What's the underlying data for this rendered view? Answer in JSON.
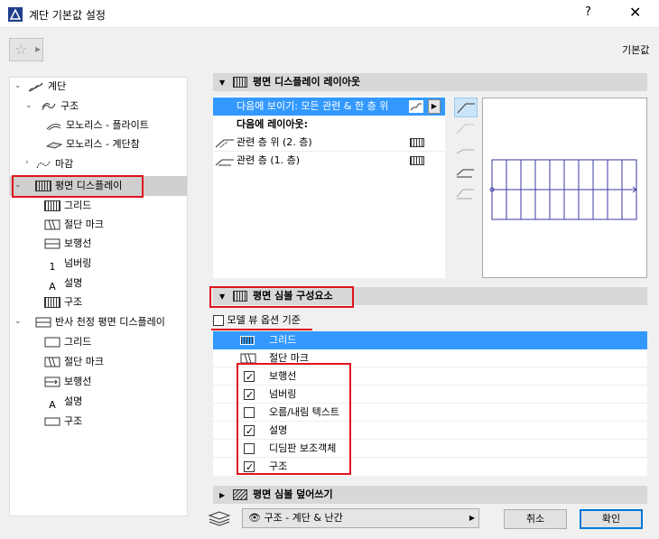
{
  "window": {
    "title": "계단 기본값 설정",
    "help": "?",
    "close": "✕"
  },
  "toolbar": {
    "favorites_icon": "star-icon",
    "default_label": "기본값"
  },
  "tree": {
    "items": [
      {
        "label": "계단"
      },
      {
        "label": "구조"
      },
      {
        "label": "모노리스 - 플라이트"
      },
      {
        "label": "모노리스 - 계단참"
      },
      {
        "label": "마감"
      },
      {
        "label": "평면 디스플레이"
      },
      {
        "label": "그리드"
      },
      {
        "label": "절단 마크"
      },
      {
        "label": "보행선"
      },
      {
        "label": "넘버링"
      },
      {
        "label": "설명"
      },
      {
        "label": "구조"
      },
      {
        "label": "반사 천정 평면 디스플레이"
      },
      {
        "label": "그리드"
      },
      {
        "label": "절단 마크"
      },
      {
        "label": "보행선"
      },
      {
        "label": "설명"
      },
      {
        "label": "구조"
      }
    ]
  },
  "layout_panel": {
    "title": "평면 디스플레이 레이아웃",
    "show_on": "다음에 보이기: 모든 관련 & 한 층 위",
    "layout_on": "다음에 레이아웃:",
    "rows": [
      {
        "label": "관련 층 위 (2. 층)"
      },
      {
        "label": "관련 층 (1. 층)"
      }
    ]
  },
  "components_panel": {
    "title": "평면 심볼 구성요소",
    "model_view_label": "모델 뷰 옵션 기준",
    "model_view_checked": false,
    "items": [
      {
        "label": "그리드",
        "checked": null,
        "selected": true
      },
      {
        "label": "절단 마크",
        "checked": null,
        "selected": false
      },
      {
        "label": "보행선",
        "checked": true,
        "selected": false
      },
      {
        "label": "넘버링",
        "checked": true,
        "selected": false
      },
      {
        "label": "오름/내림 텍스트",
        "checked": false,
        "selected": false
      },
      {
        "label": "설명",
        "checked": true,
        "selected": false
      },
      {
        "label": "디딤판 보조객체",
        "checked": false,
        "selected": false
      },
      {
        "label": "구조",
        "checked": true,
        "selected": false
      }
    ]
  },
  "override_panel": {
    "title": "평면 심볼 덮어쓰기"
  },
  "footer": {
    "layer": "구조 - 계단 & 난간",
    "cancel": "취소",
    "ok": "확인"
  },
  "colors": {
    "selection": "#3399ff",
    "highlight": "#e0141e",
    "header": "#d8d8d8"
  }
}
